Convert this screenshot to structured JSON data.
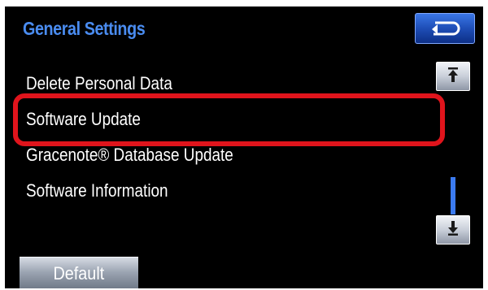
{
  "header": {
    "title": "General Settings",
    "back_icon": "return-arrow-icon"
  },
  "menu": {
    "items": [
      {
        "label": "Delete Personal Data"
      },
      {
        "label": "Software Update",
        "highlighted": true
      },
      {
        "label": "Gracenote® Database Update"
      },
      {
        "label": "Software Information"
      }
    ]
  },
  "scrollbar": {
    "up_icon": "arrow-up-to-bar-icon",
    "down_icon": "arrow-down-to-bar-icon",
    "position_fraction": 1.0
  },
  "footer": {
    "default_label": "Default"
  },
  "colors": {
    "title": "#4a8cf0",
    "highlight": "#e0141c",
    "thumb": "#3b7bf0",
    "background": "#000000"
  }
}
